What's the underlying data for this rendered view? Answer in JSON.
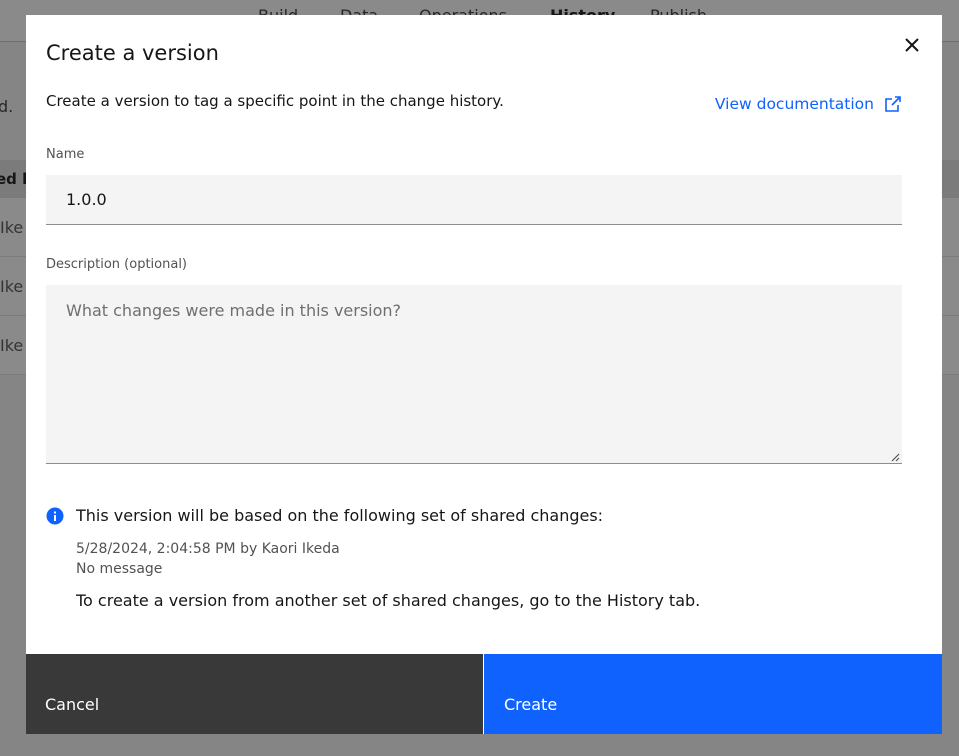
{
  "background": {
    "tabs": [
      "Build",
      "Data",
      "Operations",
      "History",
      "Publish"
    ],
    "active_tab": "History",
    "partial_text": "d.",
    "table_header": "ed b",
    "row_cells": [
      "Ike",
      "Ike",
      "Ike"
    ]
  },
  "modal": {
    "title": "Create a version",
    "intro": "Create a version to tag a specific point in the change history.",
    "doc_link": "View documentation",
    "name_label": "Name",
    "name_value": "1.0.0",
    "description_label": "Description (optional)",
    "description_placeholder": "What changes were made in this version?",
    "info_title": "This version will be based on the following set of shared changes:",
    "info_timestamp": "5/28/2024, 2:04:58 PM by Kaori Ikeda",
    "info_message": "No message",
    "info_footer": "To create a version from another set of shared changes, go to the History tab.",
    "cancel_label": "Cancel",
    "create_label": "Create"
  },
  "icons": {
    "close": "close-icon",
    "external_link": "external-link-icon",
    "info": "info-icon"
  },
  "colors": {
    "primary": "#0f62fe",
    "secondary": "#393939",
    "field_bg": "#f4f4f4"
  }
}
